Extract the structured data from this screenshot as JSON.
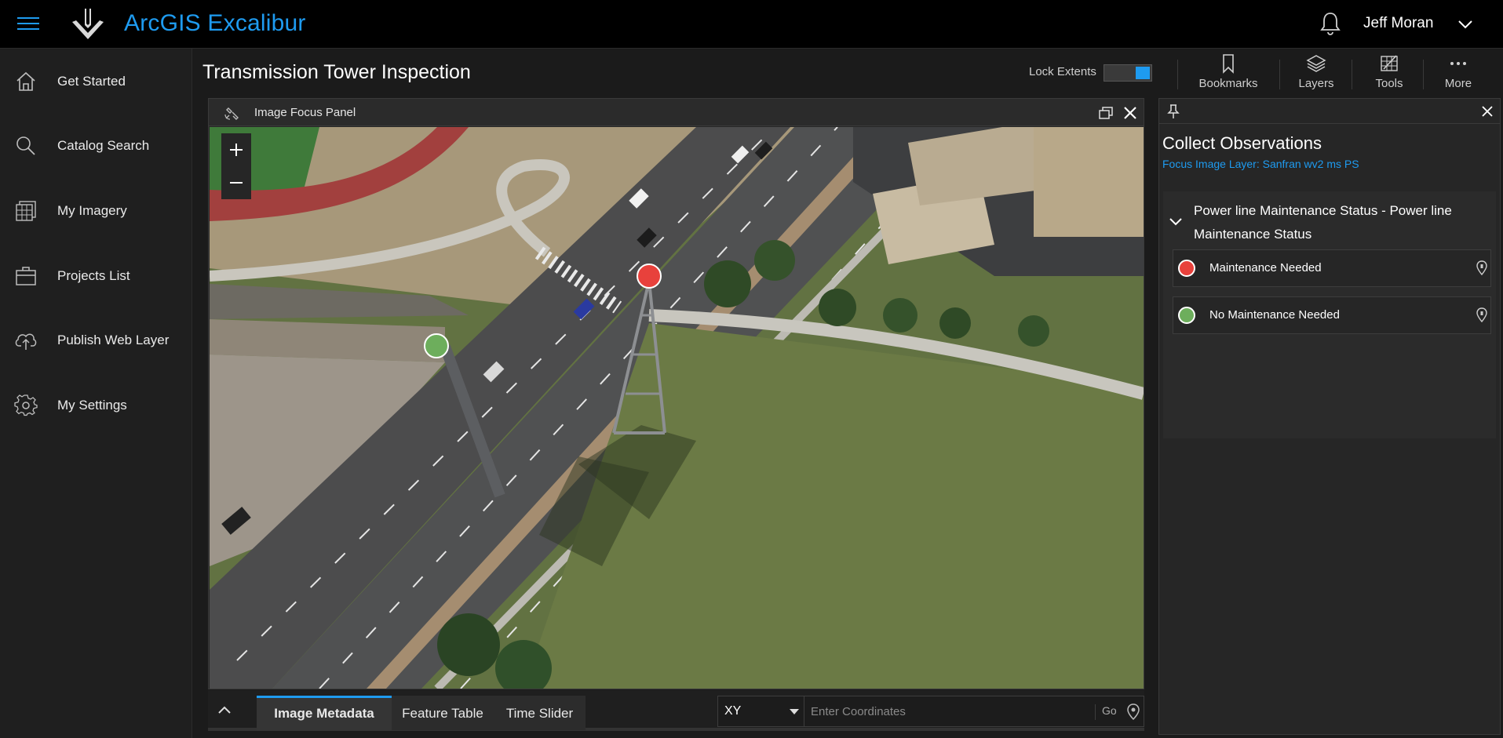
{
  "app": {
    "title": "ArcGIS Excalibur"
  },
  "user": {
    "name": "Jeff Moran"
  },
  "nav": {
    "items": [
      {
        "label": "Get Started",
        "icon": "home-icon"
      },
      {
        "label": "Catalog Search",
        "icon": "search-icon"
      },
      {
        "label": "My Imagery",
        "icon": "imagery-icon"
      },
      {
        "label": "Projects List",
        "icon": "briefcase-icon"
      },
      {
        "label": "Publish Web Layer",
        "icon": "upload-cloud-icon"
      },
      {
        "label": "My Settings",
        "icon": "gear-icon"
      }
    ]
  },
  "page": {
    "title": "Transmission Tower Inspection"
  },
  "toolbar": {
    "lock_label": "Lock Extents",
    "lock_on": true,
    "tools": [
      {
        "label": "Bookmarks",
        "icon": "bookmark-icon"
      },
      {
        "label": "Layers",
        "icon": "layers-icon"
      },
      {
        "label": "Tools",
        "icon": "tools-icon"
      },
      {
        "label": "More",
        "icon": "more-icon"
      }
    ]
  },
  "focus_panel": {
    "title": "Image Focus Panel"
  },
  "bottom": {
    "tabs": [
      "Image Metadata",
      "Feature Table",
      "Time Slider"
    ],
    "active_tab": "Image Metadata",
    "coord_system": "XY",
    "coord_placeholder": "Enter Coordinates",
    "go_label": "Go"
  },
  "observations": {
    "title": "Collect Observations",
    "subtitle": "Focus Image Layer: Sanfran wv2 ms PS",
    "group_title": "Power line Maintenance Status - Power line Maintenance Status",
    "items": [
      {
        "label": "Maintenance Needed",
        "color": "#e8413c"
      },
      {
        "label": "No Maintenance Needed",
        "color": "#6dae5c"
      }
    ]
  },
  "colors": {
    "accent": "#1e9bf0",
    "maintenance_needed": "#e8413c",
    "no_maintenance_needed": "#6dae5c"
  }
}
